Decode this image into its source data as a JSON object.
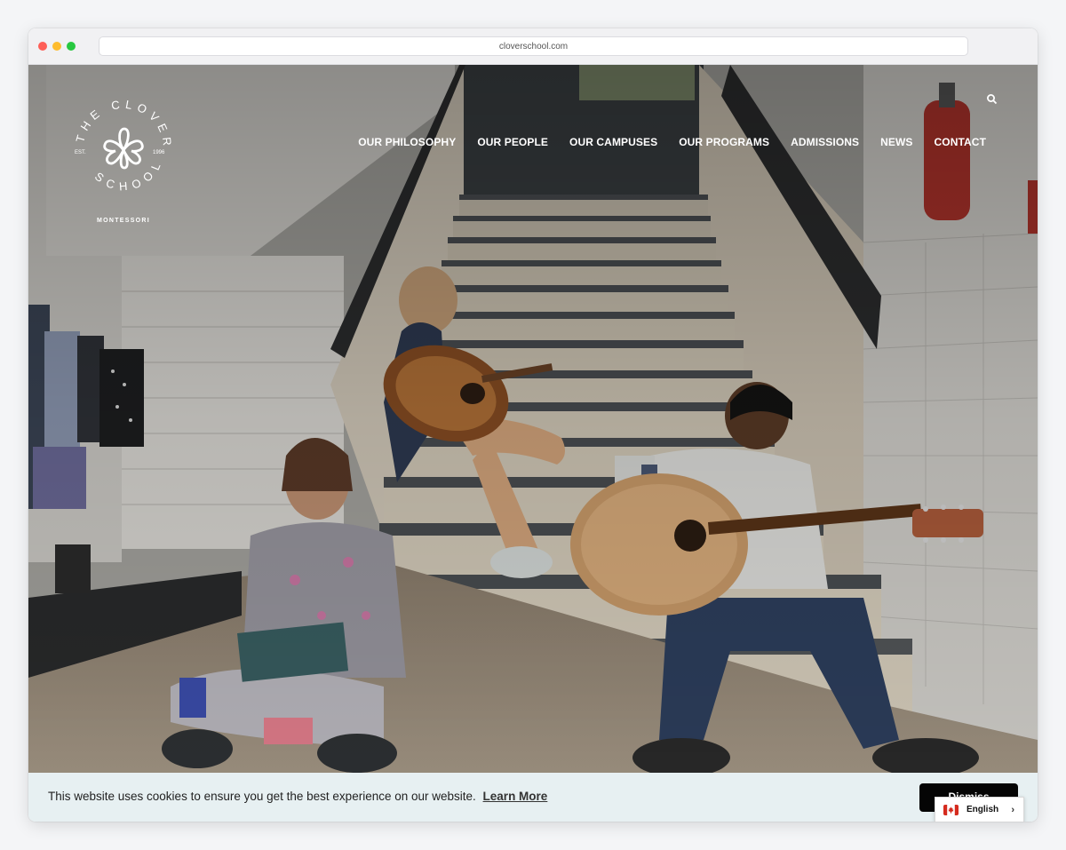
{
  "browser": {
    "url": "cloverschool.com"
  },
  "brand": {
    "ring_text": "THE CLOVER SCHOOL",
    "est": "EST.",
    "year": "1996",
    "subtitle": "MONTESSORI"
  },
  "nav": {
    "items": [
      {
        "label": "OUR PHILOSOPHY"
      },
      {
        "label": "OUR PEOPLE"
      },
      {
        "label": "OUR CAMPUSES"
      },
      {
        "label": "OUR PROGRAMS"
      },
      {
        "label": "ADMISSIONS"
      },
      {
        "label": "NEWS"
      },
      {
        "label": "CONTACT"
      }
    ]
  },
  "cookie": {
    "message": "This website uses cookies to ensure you get the best experience on our website.",
    "learn_more": "Learn More",
    "dismiss": "Dismiss"
  },
  "language": {
    "label": "English"
  },
  "colors": {
    "cookie_bg": "#e7f0f2",
    "dismiss_bg": "#050505",
    "nav_text": "#ffffff"
  }
}
